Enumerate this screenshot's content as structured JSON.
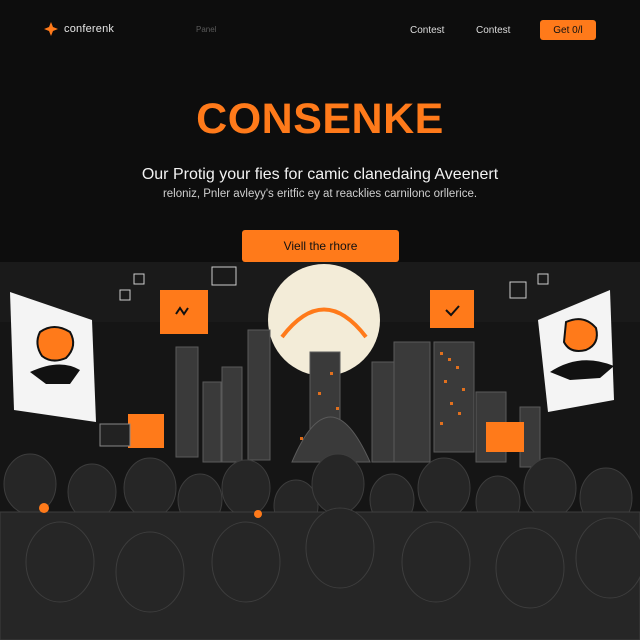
{
  "brand": {
    "name": "conferenk",
    "logo_icon": "orange-star-icon"
  },
  "nav": {
    "dim_link": "Panel",
    "links": [
      "Contest",
      "Contest"
    ],
    "button_label": "Get 0/l"
  },
  "hero": {
    "title": "CONSENKE",
    "line1": "Our Protig your fies for camic clanedaing Aveenert",
    "line2": "reloniz, Pnler avleyy's eritfic ey at reacklies carnilonc orllerice.",
    "cta_label": "Viell the rhore"
  },
  "scene": {
    "description_icons": [
      "orange-tile-icon",
      "poster-icon",
      "moon-icon",
      "crowd-silhouette-icon",
      "skyline-icon"
    ]
  },
  "colors": {
    "accent": "#ff7a1a",
    "background": "#0d0d0d",
    "text": "#f2f2f2"
  }
}
